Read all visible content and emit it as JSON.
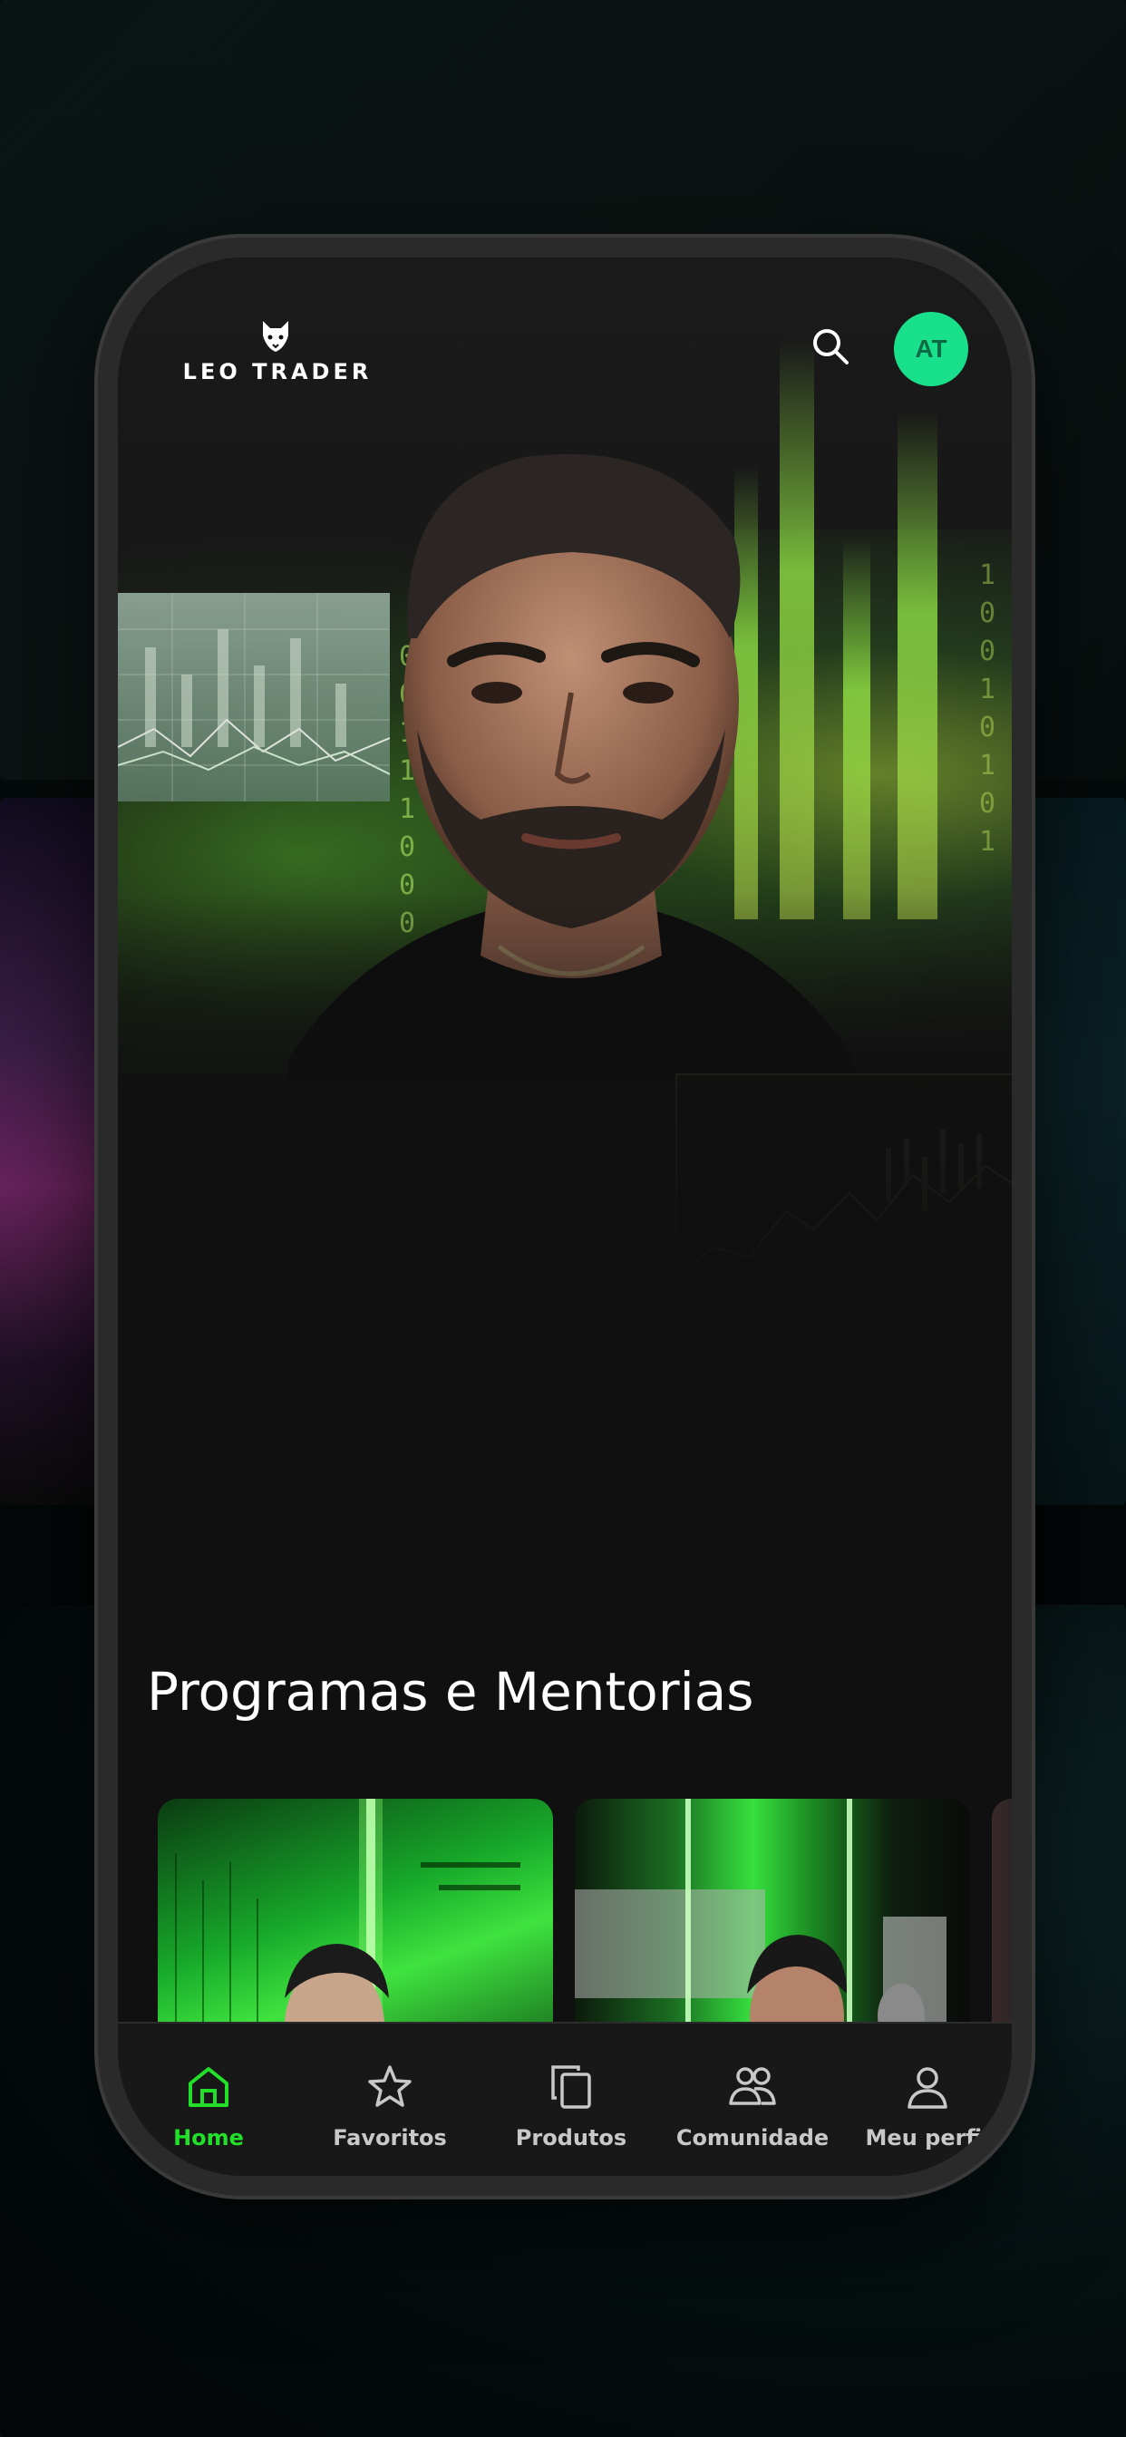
{
  "app": {
    "brand": "LEO TRADER",
    "accent_color": "#22e02a",
    "avatar_color": "#19e08a"
  },
  "header": {
    "logo_icon": "wolf-icon",
    "search_icon": "search-icon",
    "avatar_initials": "AT"
  },
  "hero": {
    "binary_left": "0\n0\n1\n1\n1\n0\n0\n0\n1\n1\n0",
    "binary_right": "1\n0\n0\n1\n0\n1\n0\n1"
  },
  "section": {
    "title": "Programas e Mentorias"
  },
  "bottom_nav": {
    "items": [
      {
        "label": "Home",
        "icon": "home-icon",
        "active": true
      },
      {
        "label": "Favoritos",
        "icon": "star-icon",
        "active": false
      },
      {
        "label": "Produtos",
        "icon": "copy-icon",
        "active": false
      },
      {
        "label": "Comunidade",
        "icon": "people-icon",
        "active": false
      },
      {
        "label": "Meu perfil",
        "icon": "user-icon",
        "active": false
      }
    ]
  }
}
